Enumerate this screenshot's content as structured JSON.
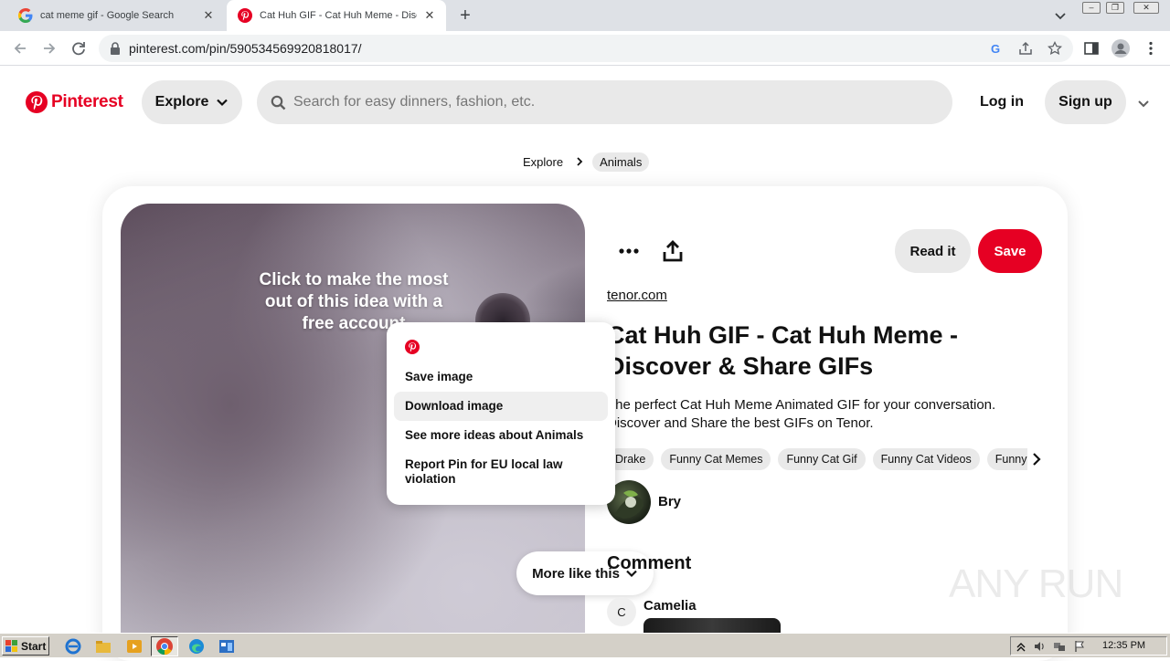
{
  "browser": {
    "tabs": [
      {
        "title": "cat meme gif - Google Search",
        "favicon": "google-icon",
        "active": false
      },
      {
        "title": "Cat Huh GIF - Cat Huh Meme - Disco",
        "favicon": "pinterest-icon",
        "active": true
      }
    ],
    "address": "pinterest.com/pin/590534569920818017/"
  },
  "pinterest": {
    "brand": "Pinterest",
    "brand_color": "#e60023",
    "explore_label": "Explore",
    "search_placeholder": "Search for easy dinners, fashion, etc.",
    "login_label": "Log in",
    "signup_label": "Sign up"
  },
  "breadcrumb": [
    "Explore",
    "Animals"
  ],
  "pin": {
    "cta": "Click to make the most out of this idea with a free account",
    "more_like_this": "More like this",
    "read_it_label": "Read it",
    "save_label": "Save",
    "source": "tenor.com",
    "title": "Cat Huh GIF - Cat Huh Meme - Discover & Share GIFs",
    "description": "The perfect Cat Huh Meme Animated GIF for your conversation. Discover and Share the best GIFs on Tenor.",
    "tags": [
      "Drake",
      "Funny Cat Memes",
      "Funny Cat Gif",
      "Funny Cat Videos",
      "Funny Cat Pictures"
    ],
    "author": "Bry",
    "comment_heading": "Comment",
    "commenter": {
      "initial": "C",
      "name": "Camelia"
    }
  },
  "context_menu": {
    "items": [
      {
        "label": "Save image",
        "highlighted": false
      },
      {
        "label": "Download image",
        "highlighted": true
      },
      {
        "label": "See more ideas about Animals",
        "highlighted": false
      },
      {
        "label": "Report Pin for EU local law violation",
        "highlighted": false
      }
    ]
  },
  "watermark": "ANY RUN",
  "taskbar": {
    "start_label": "Start",
    "clock": "12:35 PM"
  }
}
